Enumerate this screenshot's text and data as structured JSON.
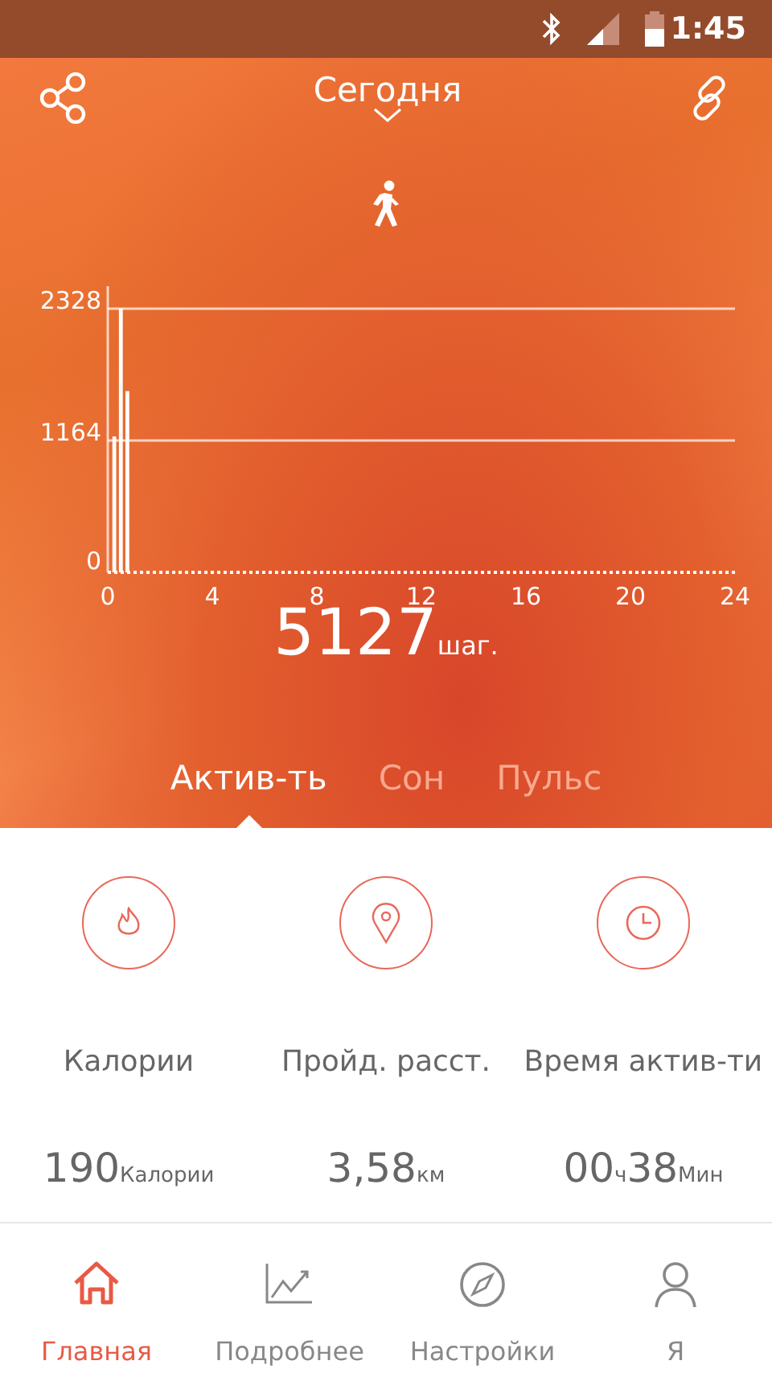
{
  "status_bar": {
    "time": "1:45"
  },
  "header": {
    "title": "Сегодня"
  },
  "chart_data": {
    "type": "bar",
    "x": [
      0.25,
      0.5,
      0.75
    ],
    "values": [
      1200,
      2328,
      1600
    ],
    "xlim": [
      0,
      24
    ],
    "ylim": [
      0,
      2328
    ],
    "xticks": [
      0,
      4,
      8,
      12,
      16,
      20,
      24
    ],
    "yticks": [
      0,
      1164,
      2328
    ]
  },
  "total": {
    "value": "5127",
    "unit": "шаг."
  },
  "tabs": [
    {
      "label": "Актив-ть",
      "selected": true
    },
    {
      "label": "Сон",
      "selected": false
    },
    {
      "label": "Пульс",
      "selected": false
    }
  ],
  "stats": [
    {
      "kind": "calories",
      "label": "Калории",
      "parts": [
        {
          "value": "190",
          "unit": "Калории"
        }
      ]
    },
    {
      "kind": "distance",
      "label": "Пройд. расст.",
      "parts": [
        {
          "value": "3,58",
          "unit": "км"
        }
      ]
    },
    {
      "kind": "time",
      "label": "Время актив-ти",
      "parts": [
        {
          "value": "00",
          "unit": "ч"
        },
        {
          "value": "38",
          "unit": "Мин"
        }
      ]
    }
  ],
  "nav": [
    {
      "kind": "home",
      "label": "Главная",
      "selected": true
    },
    {
      "kind": "chart",
      "label": "Подробнее",
      "selected": false
    },
    {
      "kind": "compass",
      "label": "Настройки",
      "selected": false
    },
    {
      "kind": "person",
      "label": "Я",
      "selected": false
    }
  ]
}
